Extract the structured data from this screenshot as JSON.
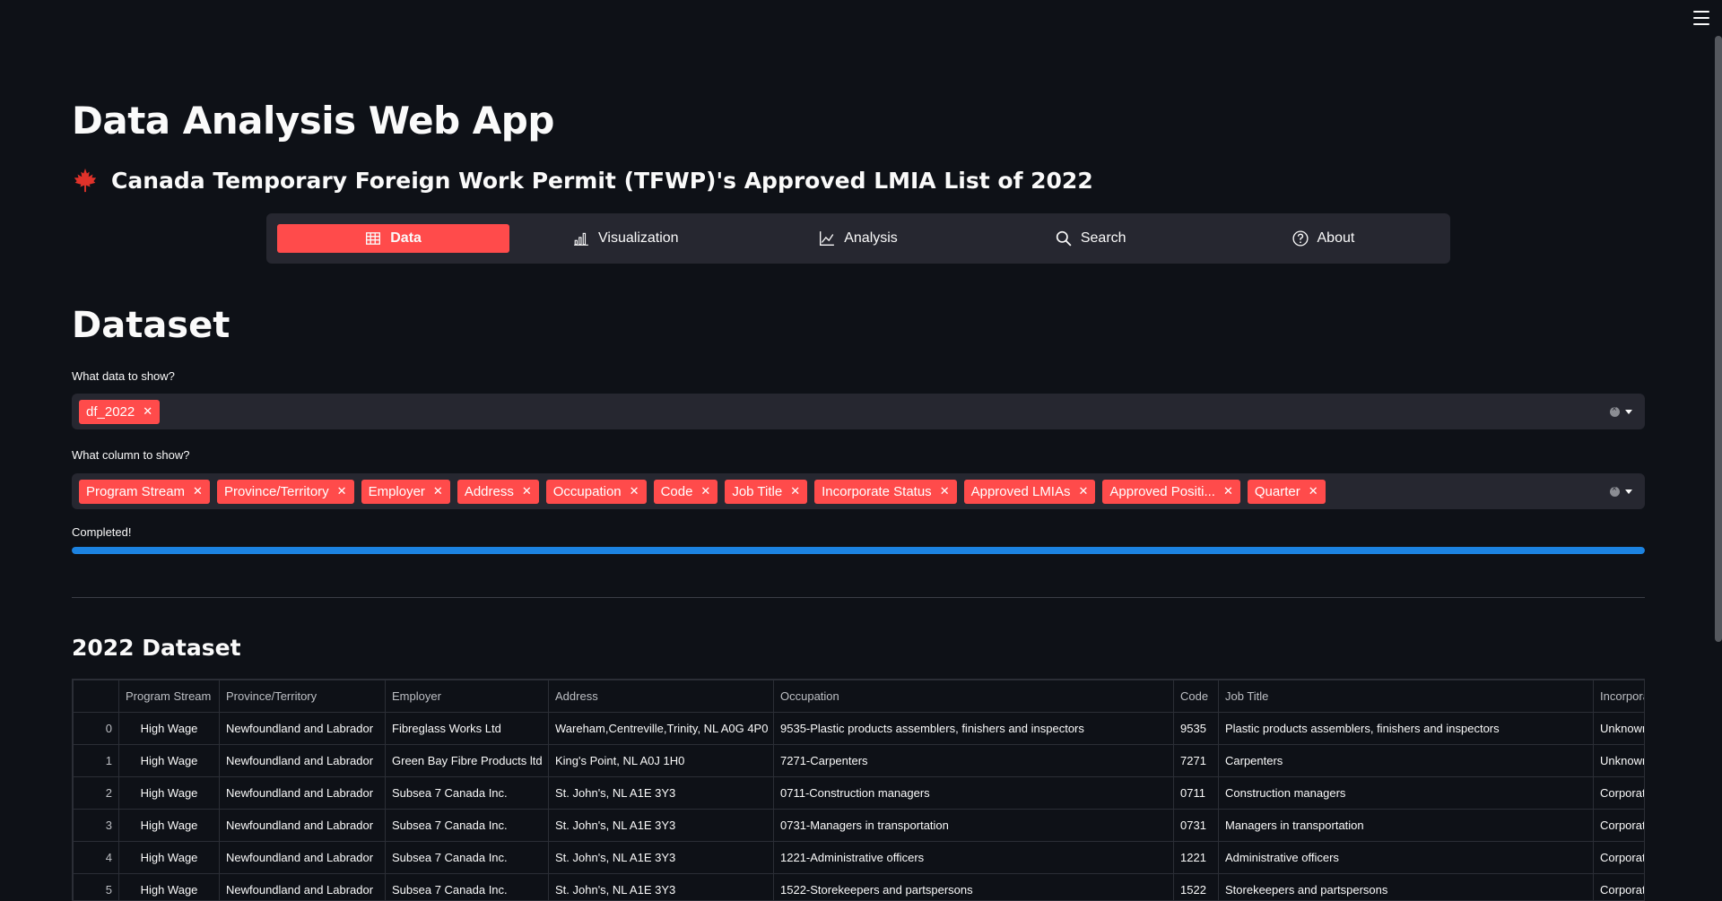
{
  "app": {
    "title": "Data Analysis Web App",
    "subtitle": "Canada Temporary Foreign Work Permit (TFWP)'s Approved LMIA List of 2022",
    "accent_color": "#ff4b4b"
  },
  "nav": {
    "items": [
      {
        "label": "Data",
        "icon": "table-icon",
        "active": true
      },
      {
        "label": "Visualization",
        "icon": "bar-chart-icon",
        "active": false
      },
      {
        "label": "Analysis",
        "icon": "line-chart-icon",
        "active": false
      },
      {
        "label": "Search",
        "icon": "search-icon",
        "active": false
      },
      {
        "label": "About",
        "icon": "question-circle-icon",
        "active": false
      }
    ]
  },
  "dataset": {
    "title": "Dataset",
    "data_select": {
      "label": "What data to show?",
      "selected": [
        "df_2022"
      ]
    },
    "column_select": {
      "label": "What column to show?",
      "selected": [
        "Program Stream",
        "Province/Territory",
        "Employer",
        "Address",
        "Occupation",
        "Code",
        "Job Title",
        "Incorporate Status",
        "Approved LMIAs",
        "Approved Positi...",
        "Quarter"
      ]
    },
    "progress": {
      "label": "Completed!",
      "fraction": 1.0,
      "color": "#1c83e1"
    }
  },
  "table": {
    "title": "2022 Dataset",
    "columns": [
      "",
      "Program Stream",
      "Province/Territory",
      "Employer",
      "Address",
      "Occupation",
      "Code",
      "Job Title",
      "Incorporat"
    ],
    "rows": [
      [
        "0",
        "High Wage",
        "Newfoundland and Labrador",
        "Fibreglass Works Ltd",
        "Wareham,Centreville,Trinity, NL A0G 4P0",
        "9535-Plastic products assemblers, finishers and inspectors",
        "9535",
        "Plastic products assemblers, finishers and inspectors",
        "Unknown"
      ],
      [
        "1",
        "High Wage",
        "Newfoundland and Labrador",
        "Green Bay Fibre Products ltd",
        "King's Point, NL A0J 1H0",
        "7271-Carpenters",
        "7271",
        "Carpenters",
        "Unknown"
      ],
      [
        "2",
        "High Wage",
        "Newfoundland and Labrador",
        "Subsea 7 Canada Inc.",
        "St. John's, NL A1E 3Y3",
        "0711-Construction managers",
        "0711",
        "Construction managers",
        "Corporatio"
      ],
      [
        "3",
        "High Wage",
        "Newfoundland and Labrador",
        "Subsea 7 Canada Inc.",
        "St. John's, NL A1E 3Y3",
        "0731-Managers in transportation",
        "0731",
        "Managers in transportation",
        "Corporatio"
      ],
      [
        "4",
        "High Wage",
        "Newfoundland and Labrador",
        "Subsea 7 Canada Inc.",
        "St. John's, NL A1E 3Y3",
        "1221-Administrative officers",
        "1221",
        "Administrative officers",
        "Corporatio"
      ],
      [
        "5",
        "High Wage",
        "Newfoundland and Labrador",
        "Subsea 7 Canada Inc.",
        "St. John's, NL A1E 3Y3",
        "1522-Storekeepers and partspersons",
        "1522",
        "Storekeepers and partspersons",
        "Corporatio"
      ]
    ]
  }
}
